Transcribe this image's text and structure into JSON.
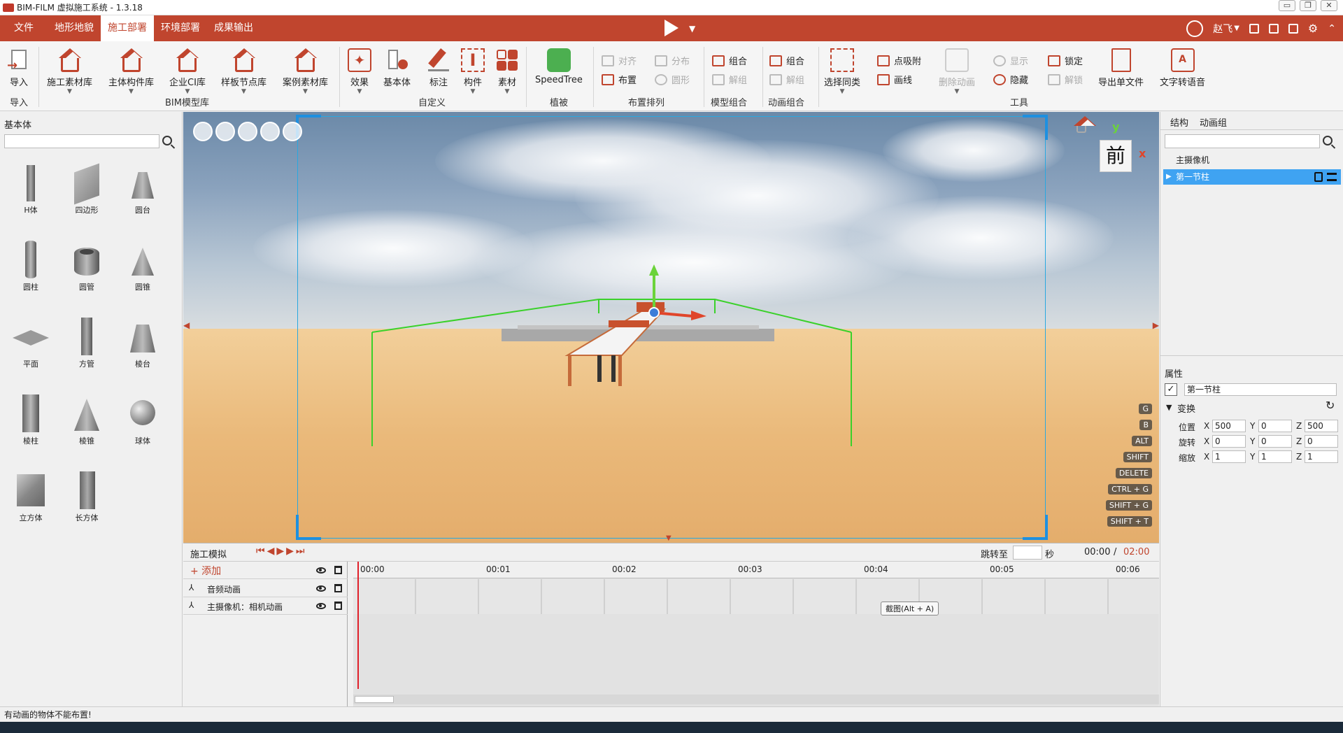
{
  "window": {
    "title": "BIM-FILM 虚拟施工系统 - 1.3.18"
  },
  "menu": {
    "items": [
      "文件",
      "地形地貌",
      "施工部署",
      "环境部署",
      "成果输出"
    ],
    "active": "施工部署"
  },
  "user": {
    "name": "赵飞"
  },
  "ribbon": {
    "import": {
      "label": "导入",
      "group": "导入"
    },
    "bim_group": "BIM模型库",
    "bim_items": [
      "施工素材库",
      "主体构件库",
      "企业CI库",
      "样板节点库",
      "案例素材库"
    ],
    "custom_group": "自定义",
    "custom_items": [
      "效果",
      "基本体",
      "标注",
      "构件",
      "素材"
    ],
    "plant_group": "植被",
    "plant_item": "SpeedTree",
    "layout_group": "布置排列",
    "layout_items": [
      "对齐",
      "分布",
      "布置",
      "圆形"
    ],
    "model_group": "模型组合",
    "model_items": [
      "组合",
      "解组"
    ],
    "anim_group": "动画组合",
    "anim_items": [
      "组合",
      "解组"
    ],
    "tools_group": "工具",
    "tools": {
      "select_same": "选择同类",
      "snap": "点吸附",
      "draw_line": "画线",
      "delete_anim": "删除动画",
      "show": "显示",
      "hide": "隐藏",
      "lock": "锁定",
      "unlock": "解锁",
      "export_list": "导出单文件",
      "tts": "文字转语音"
    }
  },
  "left_panel": {
    "title": "基本体",
    "search_placeholder": "",
    "primitives": [
      "H体",
      "四边形",
      "圆台",
      "圆柱",
      "圆管",
      "圆锥",
      "平面",
      "方管",
      "棱台",
      "棱柱",
      "棱锥",
      "球体",
      "立方体",
      "长方体"
    ]
  },
  "viewport": {
    "view_label": "前",
    "axis_y": "y",
    "axis_x": "x",
    "hotkeys": [
      "G",
      "B",
      "ALT",
      "SHIFT",
      "DELETE",
      "CTRL + G",
      "SHIFT + G",
      "SHIFT + T"
    ],
    "colors": {
      "frame": "#29a8e0",
      "bbox": "#3ad12a",
      "accent": "#c0452e"
    }
  },
  "timeline": {
    "title": "施工模拟",
    "jump_label": "跳转至",
    "jump_unit": "秒",
    "jump_value": "",
    "current_time": "00:00",
    "separator": "/",
    "total_time": "02:00",
    "add_label": "+ 添加",
    "tracks": [
      "音频动画",
      "主摄像机：相机动画"
    ],
    "ticks": [
      "00:00",
      "00:01",
      "00:02",
      "00:03",
      "00:04",
      "00:05",
      "00:06"
    ],
    "tooltip": "截图(Alt + A)"
  },
  "right_panel": {
    "tabs": [
      "结构",
      "动画组"
    ],
    "tree": [
      "主摄像机",
      "第一节柱"
    ],
    "properties_title": "属性",
    "object_name": "第一节柱",
    "transform_title": "变换",
    "position_label": "位置",
    "rotation_label": "旋转",
    "scale_label": "缩放",
    "position": {
      "x": "500",
      "y": "0",
      "z": "500"
    },
    "rotation": {
      "x": "0",
      "y": "0",
      "z": "0"
    },
    "scale": {
      "x": "1",
      "y": "1",
      "z": "1"
    },
    "axis_labels": [
      "X",
      "Y",
      "Z"
    ]
  },
  "status": {
    "message": "有动画的物体不能布置!"
  }
}
